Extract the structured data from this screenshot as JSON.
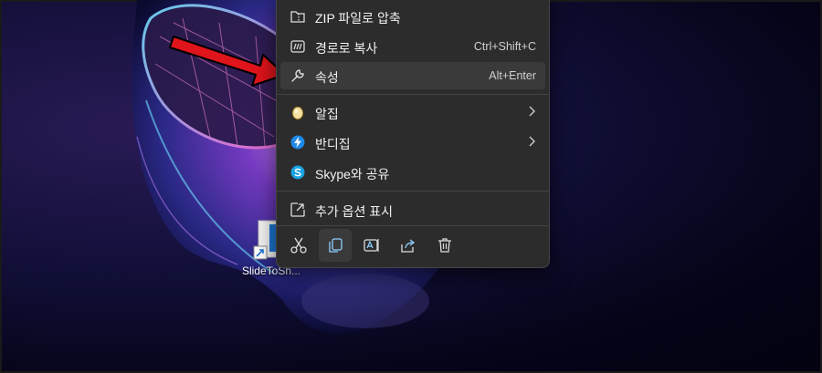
{
  "desktop": {
    "icon_label": "SlideToSh..."
  },
  "menu": {
    "items": [
      {
        "label": "ZIP 파일로 압축",
        "icon": "zip-icon"
      },
      {
        "label": "경로로 복사",
        "shortcut": "Ctrl+Shift+C",
        "icon": "copy-path-icon"
      },
      {
        "label": "속성",
        "shortcut": "Alt+Enter",
        "icon": "wrench-icon"
      },
      {
        "label": "알집",
        "icon": "alzip-icon"
      },
      {
        "label": "반디집",
        "icon": "bandizip-icon"
      },
      {
        "label": "Skype와 공유",
        "icon": "skype-icon"
      },
      {
        "label": "추가 옵션 표시",
        "icon": "more-options-icon"
      }
    ],
    "toolbar": [
      "cut-icon",
      "copy-icon",
      "rename-icon",
      "share-icon",
      "delete-icon"
    ]
  },
  "colors": {
    "menu_bg": "#2c2c2c",
    "annotation_arrow": "#e0141b",
    "bandizip": "#1e88e5",
    "skype": "#1aa3e0"
  }
}
